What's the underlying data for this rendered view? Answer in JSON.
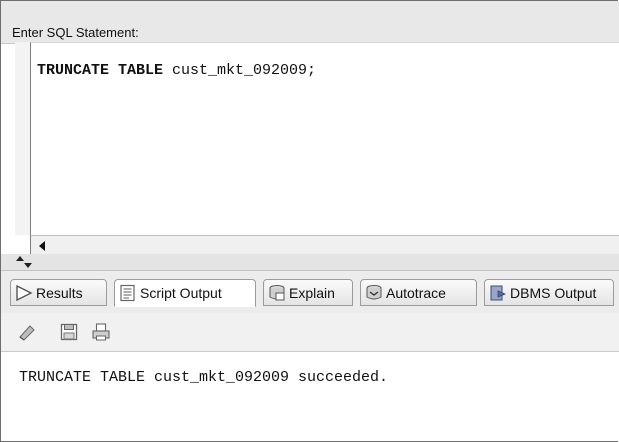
{
  "sql_panel": {
    "label": "Enter SQL Statement:",
    "statement_keyword": "TRUNCATE TABLE",
    "statement_rest": " cust_mkt_092009;"
  },
  "tabs": [
    {
      "label": "Results",
      "icon": "triangle-arrow-icon"
    },
    {
      "label": "Script Output",
      "icon": "script-page-icon",
      "active": true
    },
    {
      "label": "Explain",
      "icon": "explain-plan-icon"
    },
    {
      "label": "Autotrace",
      "icon": "autotrace-icon"
    },
    {
      "label": "DBMS Output",
      "icon": "dbms-output-icon"
    }
  ],
  "toolbar": {
    "icons": [
      "eraser-icon",
      "save-icon",
      "print-icon"
    ]
  },
  "output": {
    "text": "TRUNCATE TABLE cust_mkt_092009 succeeded."
  }
}
